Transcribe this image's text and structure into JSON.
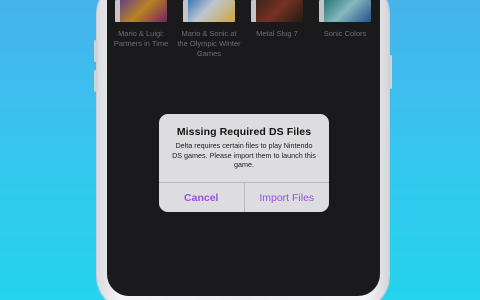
{
  "games": [
    {
      "title": "Mario & Luigi: Partners in Time",
      "art": "game-art-mario-luigi"
    },
    {
      "title": "Mario & Sonic at the Olympic Winter Games",
      "art": "game-art-mario-sonic"
    },
    {
      "title": "Metal Slug 7",
      "art": "game-art-metal-slug"
    },
    {
      "title": "Sonic Colors",
      "art": "game-art-sonic-colors"
    }
  ],
  "alert": {
    "title": "Missing Required DS Files",
    "message": "Delta requires certain files to play Nintendo DS games. Please import them to launch this game.",
    "cancel_label": "Cancel",
    "import_label": "Import Files"
  },
  "colors": {
    "accent": "#9b4de6",
    "background_top": "#47b3ec",
    "background_bottom": "#25d4ee",
    "screen": "#1f1f21",
    "alert_bg": "#e4e4e6"
  }
}
